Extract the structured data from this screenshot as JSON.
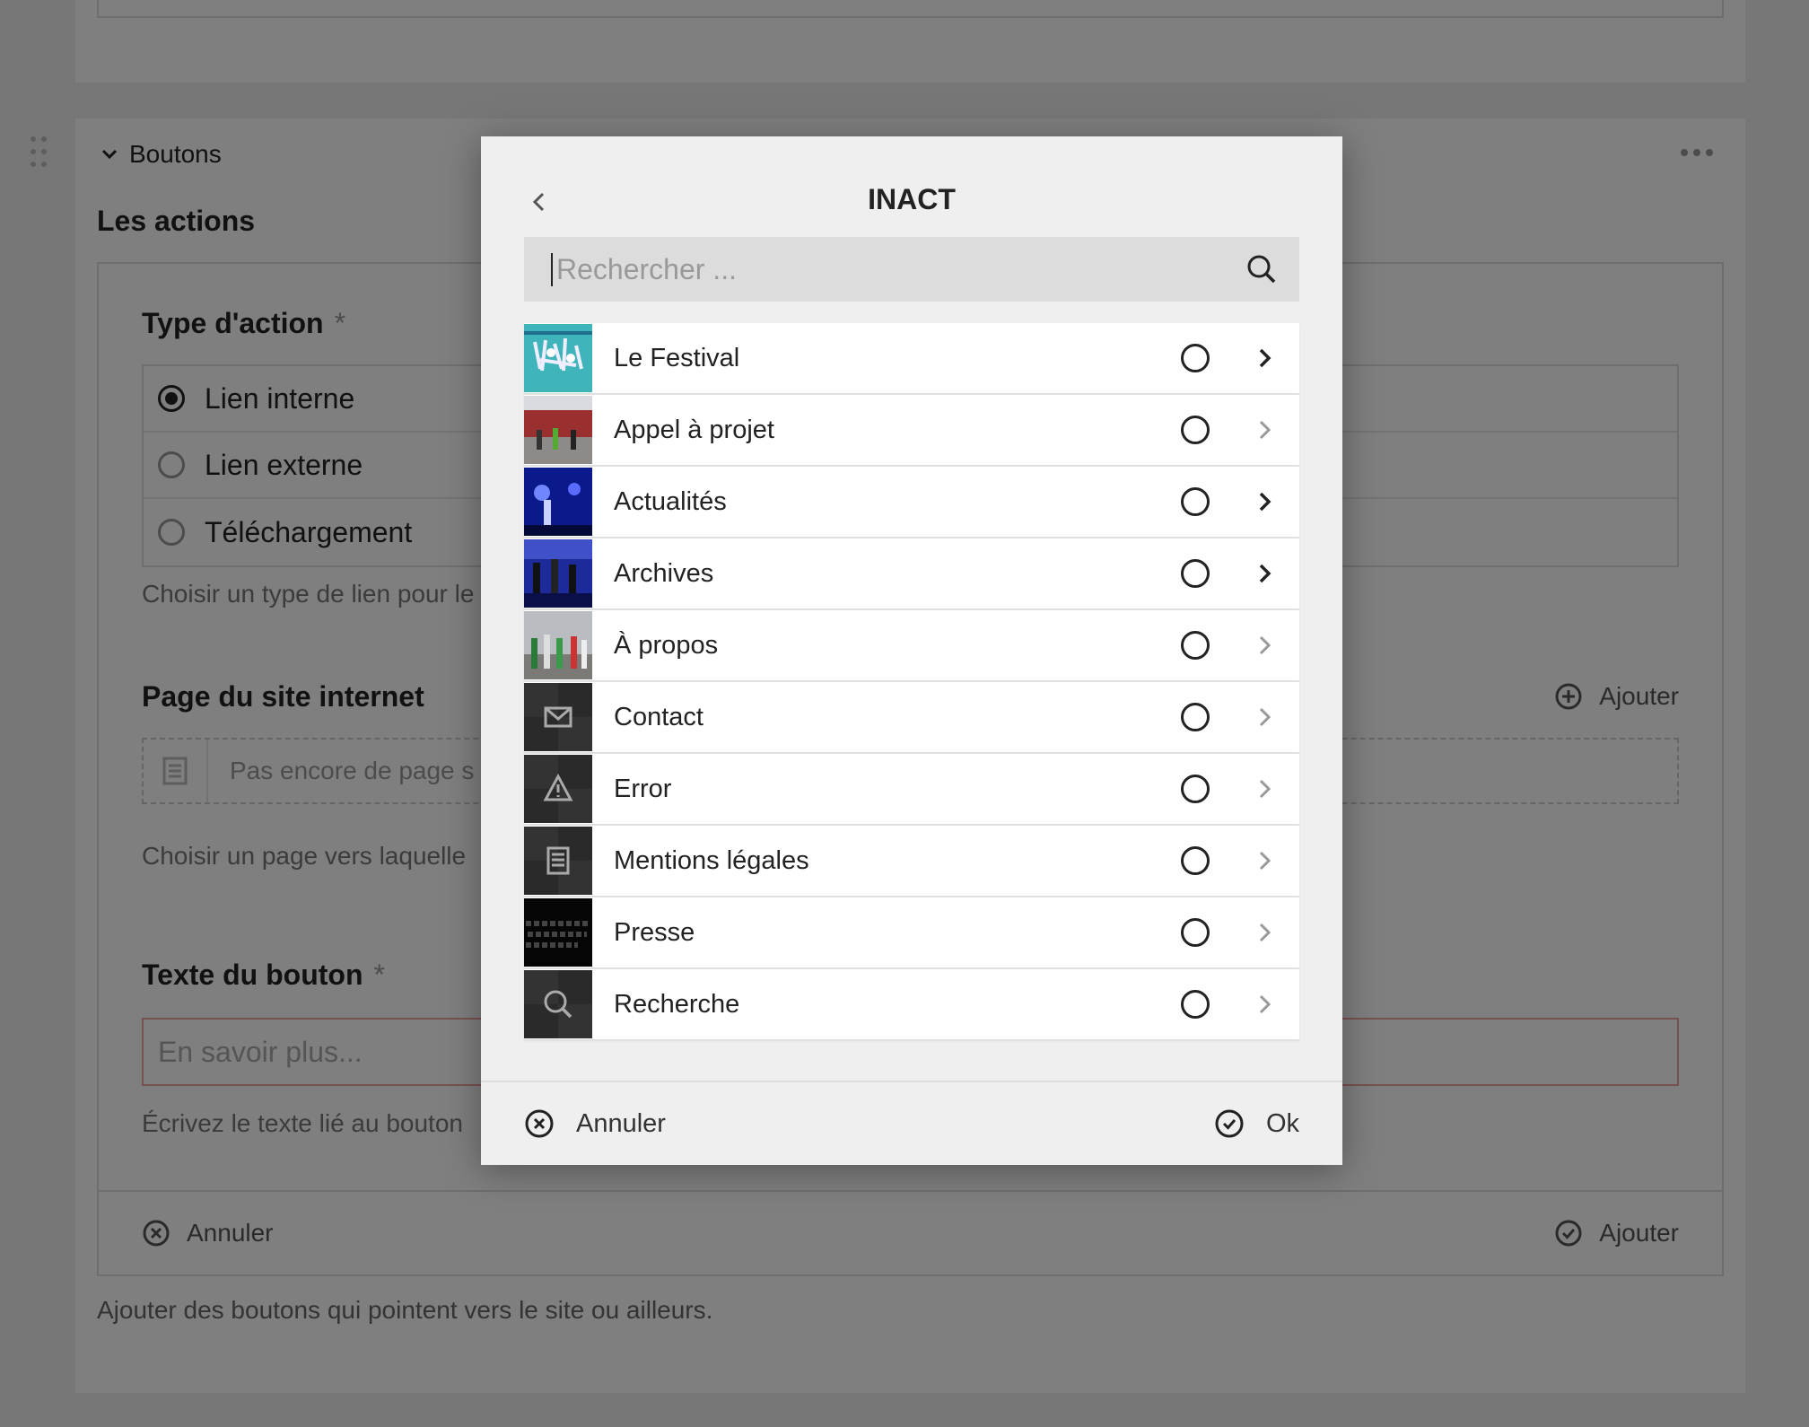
{
  "background": {
    "section_title": "Boutons",
    "field_title": "Les actions",
    "action_type": {
      "label": "Type d'action",
      "required_mark": "*",
      "options": [
        {
          "label": "Lien interne",
          "selected": true
        },
        {
          "label": "Lien externe",
          "selected": false
        },
        {
          "label": "Téléchargement",
          "selected": false
        }
      ],
      "help": "Choisir un type de lien pour le"
    },
    "page": {
      "label": "Page du site internet",
      "add_label": "Ajouter",
      "empty_text": "Pas encore de page s",
      "help": "Choisir un page vers laquelle"
    },
    "button_text": {
      "label": "Texte du bouton",
      "required_mark": "*",
      "placeholder": "En savoir plus...",
      "help": "Écrivez le texte lié au bouton"
    },
    "footer": {
      "cancel_label": "Annuler",
      "add_label": "Ajouter"
    },
    "bottom_help": "Ajouter des boutons qui pointent vers le site ou ailleurs."
  },
  "dialog": {
    "title": "INACT",
    "search_placeholder": "Rechercher ...",
    "items": [
      {
        "label": "Le Festival",
        "thumb": "image-teal",
        "has_children": true
      },
      {
        "label": "Appel à projet",
        "thumb": "image-street",
        "has_children": false
      },
      {
        "label": "Actualités",
        "thumb": "image-blue-stage",
        "has_children": true
      },
      {
        "label": "Archives",
        "thumb": "image-blue-concert",
        "has_children": true
      },
      {
        "label": "À propos",
        "thumb": "image-parade",
        "has_children": false
      },
      {
        "label": "Contact",
        "thumb": "envelope-icon",
        "has_children": false
      },
      {
        "label": "Error",
        "thumb": "warning-icon",
        "has_children": false
      },
      {
        "label": "Mentions légales",
        "thumb": "document-icon",
        "has_children": false
      },
      {
        "label": "Presse",
        "thumb": "image-text-dark",
        "has_children": false
      },
      {
        "label": "Recherche",
        "thumb": "search-icon",
        "has_children": false
      }
    ],
    "footer": {
      "cancel_label": "Annuler",
      "ok_label": "Ok"
    }
  },
  "colors": {
    "overlay": "#00000080",
    "dialog_bg": "#efefef",
    "accent_dark": "#222222",
    "error_border": "#f0a5a0"
  }
}
